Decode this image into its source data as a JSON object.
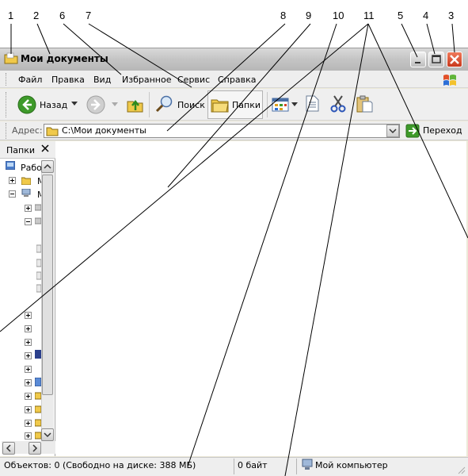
{
  "callouts": [
    "1",
    "2",
    "6",
    "7",
    "8",
    "9",
    "10",
    "11",
    "5",
    "4",
    "3"
  ],
  "window": {
    "title": "Мои документы"
  },
  "menu": {
    "items": [
      "Файл",
      "Правка",
      "Вид",
      "Избранное",
      "Сервис",
      "Справка"
    ]
  },
  "toolbar": {
    "back_label": "Назад",
    "search_label": "Поиск",
    "folders_label": "Папки"
  },
  "address": {
    "label": "Адрес:",
    "value": "C:\\Мои документы",
    "go_label": "Переход"
  },
  "folders_pane": {
    "title": "Папки",
    "root_label": "Рабо",
    "item_m1": "М",
    "item_m2": "М"
  },
  "status": {
    "objects": "Объектов: 0 (Свободно на диске: 388 МБ)",
    "size": "0 байт",
    "location": "Мой компьютер"
  },
  "colors": {
    "close_button": "#d9452a",
    "back_arrow": "#3e9a2a",
    "folder": "#f0c94a",
    "go_arrow": "#3e9a2a"
  }
}
